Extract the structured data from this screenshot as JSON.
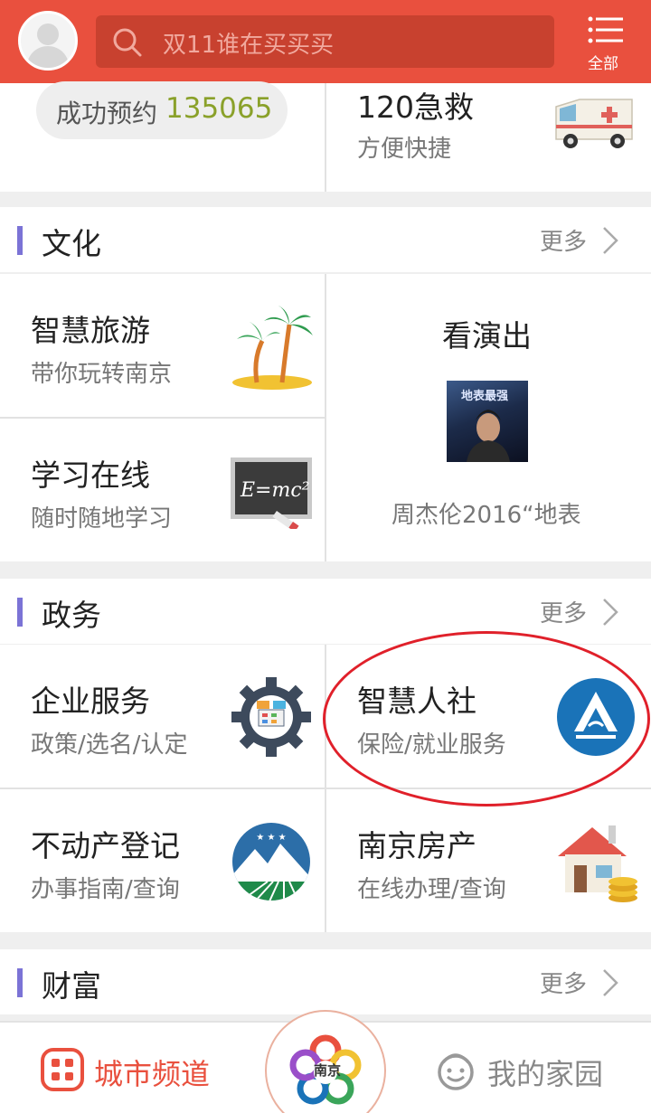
{
  "header": {
    "search_placeholder": "双11谁在买买买",
    "menu_label": "全部"
  },
  "top_card": {
    "reserve_label": "成功预约",
    "reserve_count": "135065",
    "emergency_title": "120急救",
    "emergency_sub": "方便快捷"
  },
  "culture": {
    "title": "文化",
    "more": "更多",
    "tour_title": "智慧旅游",
    "tour_sub": "带你玩转南京",
    "study_title": "学习在线",
    "study_sub": "随时随地学习",
    "show_title": "看演出",
    "show_caption": "周杰伦2016“地表",
    "poster_text": "地表最强"
  },
  "gov": {
    "title": "政务",
    "more": "更多",
    "biz_title": "企业服务",
    "biz_sub": "政策/选名/认定",
    "hr_title": "智慧人社",
    "hr_sub": "保险/就业服务",
    "estate_title": "不动产登记",
    "estate_sub": "办事指南/查询",
    "house_title": "南京房产",
    "house_sub": "在线办理/查询"
  },
  "wealth": {
    "title": "财富",
    "more": "更多"
  },
  "bottom_nav": {
    "left_label": "城市频道",
    "center_logo_text": "南京",
    "right_label": "我的家园"
  },
  "colors": {
    "brand": "#e9503e",
    "section_bar": "#7b73d6",
    "count_green": "#8aa12a",
    "annotation_red": "#e0202a"
  },
  "icons": {
    "avatar": "user-avatar",
    "search": "search-icon",
    "menu": "list-menu-icon",
    "ambulance": "ambulance-icon",
    "palm": "palm-tree-icon",
    "blackboard": "formula-blackboard-icon",
    "gear": "gear-icon",
    "hr_logo": "social-security-logo-icon",
    "mountain": "mountain-emblem-icon",
    "house": "house-coins-icon",
    "grid": "city-grid-icon",
    "smile": "smile-face-icon",
    "chevron": "chevron-right-icon"
  }
}
